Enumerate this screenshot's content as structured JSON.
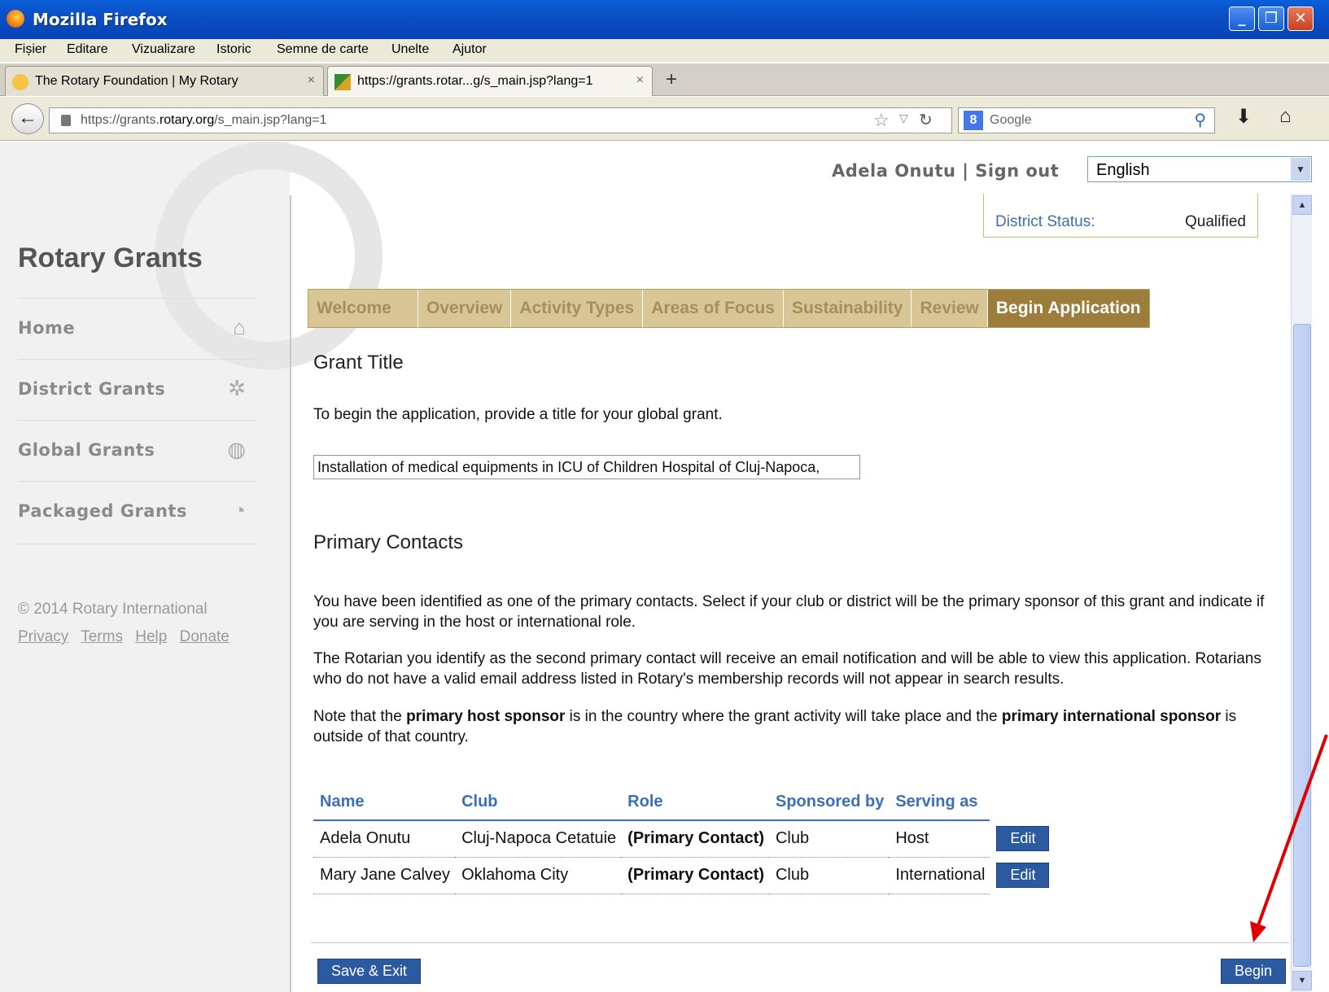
{
  "window": {
    "title": "Mozilla Firefox"
  },
  "menu": [
    "Fișier",
    "Editare",
    "Vizualizare",
    "Istoric",
    "Semne de carte",
    "Unelte",
    "Ajutor"
  ],
  "tabs": [
    {
      "label": "The Rotary Foundation | My Rotary"
    },
    {
      "label": "https://grants.rotar...g/s_main.jsp?lang=1"
    }
  ],
  "address": {
    "prefix": "https://grants.",
    "domain": "rotary.org",
    "suffix": "/s_main.jsp?lang=1"
  },
  "search": {
    "placeholder": "Google"
  },
  "header": {
    "user": "Adela Onutu",
    "separator": " | ",
    "signout": "Sign out",
    "language": "English"
  },
  "district": {
    "status_label": "District Status:",
    "status_value": "Qualified"
  },
  "sidebar": {
    "brand": "Rotary Grants",
    "items": [
      {
        "label": "Home",
        "icon": "home-icon"
      },
      {
        "label": "District Grants",
        "icon": "gear-icon"
      },
      {
        "label": "Global Grants",
        "icon": "globe-icon"
      },
      {
        "label": "Packaged Grants",
        "icon": "refresh-icon"
      }
    ],
    "copyright": "© 2014 Rotary International",
    "links": [
      "Privacy",
      "Terms",
      "Help",
      "Donate"
    ]
  },
  "wizard": {
    "steps": [
      "Welcome",
      "Overview",
      "Activity Types",
      "Areas of Focus",
      "Sustainability",
      "Review",
      "Begin Application"
    ],
    "active": "Begin Application"
  },
  "grant": {
    "heading": "Grant Title",
    "instruction": "To begin the application, provide a title for your global grant.",
    "title_value": "Installation of medical equipments in ICU of Children Hospital of Cluj-Napoca,"
  },
  "contacts": {
    "heading": "Primary Contacts",
    "para1": "You have been identified as one of the primary contacts. Select if your club or district will be the primary sponsor of this grant and indicate if you are serving in the host or international role.",
    "para2": "The Rotarian you identify as the second primary contact will receive an email notification and will be able to view this application. Rotarians who do not have a valid email address listed in Rotary's membership records will not appear in search results.",
    "para3_a": "Note that the ",
    "para3_b": "primary host sponsor",
    "para3_c": " is in the country where the grant activity will take place and the ",
    "para3_d": "primary international sponsor",
    "para3_e": " is outside of that country.",
    "columns": [
      "Name",
      "Club",
      "Role",
      "Sponsored by",
      "Serving as"
    ],
    "rows": [
      {
        "name": "Adela Onutu",
        "club": "Cluj-Napoca Cetatuie",
        "role": "(Primary Contact)",
        "sponsored": "Club",
        "serving": "Host",
        "action": "Edit"
      },
      {
        "name": "Mary Jane Calvey",
        "club": "Oklahoma City",
        "role": "(Primary Contact)",
        "sponsored": "Club",
        "serving": "International",
        "action": "Edit"
      }
    ]
  },
  "actions": {
    "save": "Save & Exit",
    "begin": "Begin"
  },
  "colors": {
    "accent": "#2c5aa0",
    "wizard_active": "#9c7d3c",
    "wizard_inactive": "#d8c795",
    "annotation_arrow": "#e00000"
  }
}
